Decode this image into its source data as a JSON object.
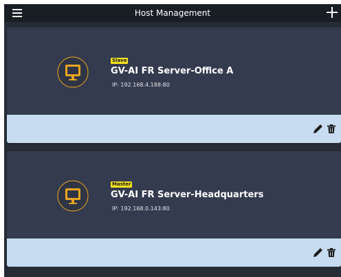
{
  "header": {
    "title": "Host Management"
  },
  "colors": {
    "accent_badge": "#f2e21f",
    "icon_ring": "#e9a520",
    "card_footer": "#c8dcf1",
    "card_body": "#343b4f"
  },
  "hosts": [
    {
      "role": "Slave",
      "name": "GV-AI FR Server-Office A",
      "ip": "IP: 192.168.4.188:80",
      "icon": "monitor-icon"
    },
    {
      "role": "Master",
      "name": "GV-AI FR Server-Headquarters",
      "ip": "IP: 192.168.0.143:80",
      "icon": "monitor-icon"
    }
  ]
}
